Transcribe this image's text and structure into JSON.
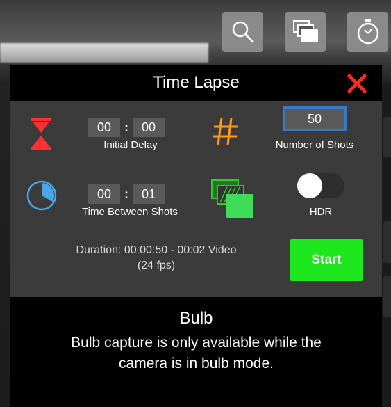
{
  "toolbar": {
    "icons": [
      "search-icon",
      "layers-icon",
      "timer-icon"
    ]
  },
  "panel": {
    "title": "Time Lapse",
    "initial_delay": {
      "minutes": "00",
      "seconds": "00",
      "label": "Initial Delay"
    },
    "number_of_shots": {
      "value": "50",
      "label": "Number of Shots"
    },
    "time_between": {
      "minutes": "00",
      "seconds": "01",
      "label": "Time Between Shots"
    },
    "hdr": {
      "label": "HDR",
      "enabled": false
    },
    "duration_line1": "Duration: 00:00:50 - 00:02 Video",
    "duration_line2": "(24 fps)",
    "start_label": "Start",
    "colon": ":"
  },
  "bulb": {
    "title": "Bulb",
    "description_line1": "Bulb capture is only available while the",
    "description_line2": "camera is in bulb mode."
  },
  "colors": {
    "close": "#ff2a1a",
    "hourglass": "#ff3030",
    "hash": "#ff9b14",
    "clock": "#4aa6e8",
    "start": "#1de81d",
    "shots_border": "#3a79c5"
  }
}
